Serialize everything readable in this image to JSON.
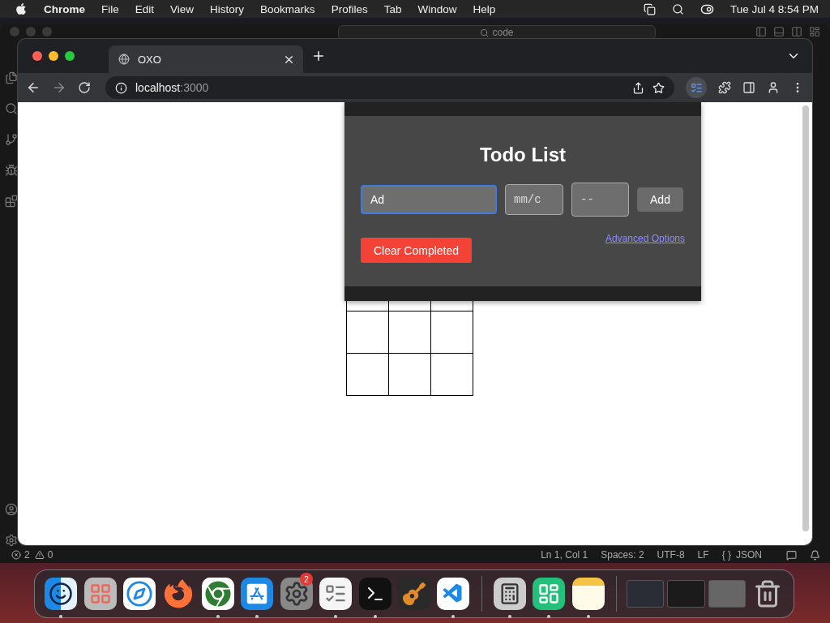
{
  "menu_bar": {
    "app": "Chrome",
    "items": [
      "File",
      "Edit",
      "View",
      "History",
      "Bookmarks",
      "Profiles",
      "Tab",
      "Window",
      "Help"
    ],
    "clock": "Tue Jul 4  8:54 PM"
  },
  "editor_window": {
    "search": "code",
    "status_bar": {
      "errors": "2",
      "warnings": "0",
      "items": [
        "Ln 1, Col 1",
        "Spaces: 2",
        "UTF-8",
        "LF"
      ],
      "braces": "{ }",
      "language": "JSON"
    }
  },
  "browser": {
    "tabs": [
      {
        "label": "OXO",
        "selected": true
      }
    ],
    "address": {
      "host": "localhost",
      "port": ":3000"
    }
  },
  "popup": {
    "title": "Todo List",
    "task_field": {
      "value": "Ad",
      "focused": true
    },
    "date_field": {
      "placeholder": "mm/c"
    },
    "time_field": {
      "placeholder": "--"
    },
    "add_button": "Add",
    "link": "Advanced Options",
    "clear_button": "Clear Completed"
  },
  "dock": {
    "apps": [
      {
        "kind": "finder",
        "running": true
      },
      {
        "kind": "launchpad",
        "running": false
      },
      {
        "kind": "safari",
        "running": false
      },
      {
        "kind": "firefox",
        "running": false
      },
      {
        "kind": "chrome",
        "running": true
      },
      {
        "kind": "appstore",
        "running": true
      },
      {
        "kind": "settings",
        "running": false,
        "badge": "2"
      },
      {
        "kind": "textedit",
        "running": true
      },
      {
        "kind": "terminal",
        "running": true
      },
      {
        "kind": "guitar",
        "running": false
      },
      {
        "kind": "vscode",
        "running": true
      },
      {
        "kind": "calculator",
        "running": true
      },
      {
        "kind": "greenapp",
        "running": true
      },
      {
        "kind": "notes",
        "running": true
      }
    ],
    "windows": [
      {
        "kind": "editor"
      },
      {
        "kind": "terminal"
      },
      {
        "kind": "calculator"
      }
    ]
  }
}
